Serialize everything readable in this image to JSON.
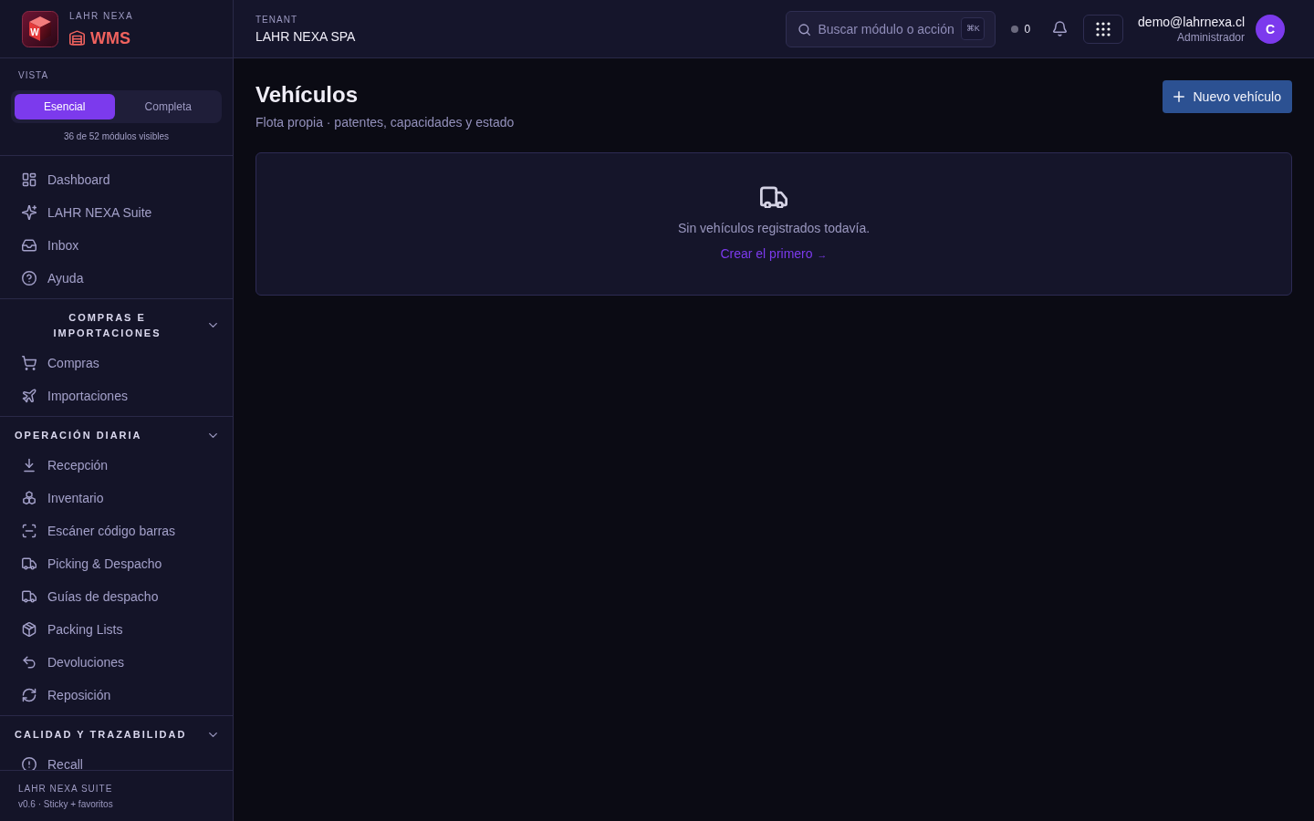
{
  "brand": {
    "logo_letter": "W",
    "company": "LAHR NEXA",
    "product": "WMS"
  },
  "view_switch": {
    "label": "VISTA",
    "options": [
      {
        "label": "Esencial",
        "selected": true
      },
      {
        "label": "Completa",
        "selected": false
      }
    ],
    "note": "36 de 52 módulos visibles"
  },
  "sidebar": {
    "sections": [
      {
        "items": [
          {
            "label": "Dashboard",
            "selected": false
          },
          {
            "label": "LAHR NEXA Suite",
            "selected": false
          },
          {
            "label": "Inbox",
            "selected": false
          },
          {
            "label": "Ayuda",
            "selected": false
          }
        ]
      },
      {
        "title": "COMPRAS E IMPORTACIONES",
        "expanded": true,
        "items": [
          {
            "label": "Compras",
            "selected": false
          },
          {
            "label": "Importaciones",
            "selected": false
          }
        ]
      },
      {
        "title": "OPERACIÓN DIARIA",
        "expanded": true,
        "items": [
          {
            "label": "Recepción",
            "selected": false
          },
          {
            "label": "Inventario",
            "selected": false
          },
          {
            "label": "Escáner código barras",
            "selected": false
          },
          {
            "label": "Picking & Despacho",
            "selected": false
          },
          {
            "label": "Guías de despacho",
            "selected": false
          },
          {
            "label": "Packing Lists",
            "selected": false
          },
          {
            "label": "Devoluciones",
            "selected": false
          },
          {
            "label": "Reposición",
            "selected": false
          }
        ]
      },
      {
        "title": "CALIDAD Y TRAZABILIDAD",
        "expanded": true,
        "items": [
          {
            "label": "Recall",
            "selected": false
          }
        ]
      }
    ]
  },
  "sidebar_footer": {
    "title": "LAHR NEXA SUITE",
    "version": "v0.6 · Sticky + favoritos"
  },
  "topbar": {
    "tenant_label": "TENANT",
    "tenant": "LAHR NEXA SPA",
    "search": {
      "placeholder": "Buscar módulo o acción",
      "shortcut": "⌘K"
    },
    "status_count": "0",
    "user": {
      "email": "demo@lahrnexa.cl",
      "role": "Administrador",
      "initial": "C"
    }
  },
  "page": {
    "title": "Vehículos",
    "subtitle": "Flota propia · patentes, capacidades y estado",
    "primary_button": {
      "label": "Nuevo vehículo"
    },
    "empty_state": {
      "message": "Sin vehículos registrados todavía.",
      "link": {
        "label": "Crear el primero",
        "arrow": "→"
      }
    }
  }
}
